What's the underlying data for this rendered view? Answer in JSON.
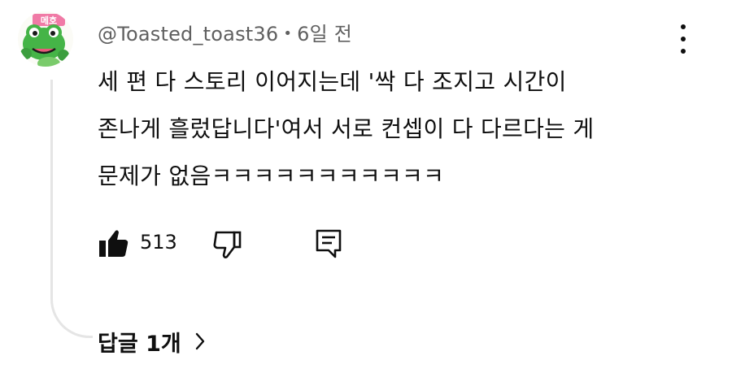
{
  "comment": {
    "author": "@Toasted_toast36",
    "separator": "•",
    "timestamp": "6일 전",
    "text_lines": [
      "세 편 다 스토리 이어지는데 '싹 다 조지고 시간이",
      "존나게 흘렀답니다'여서 서로 컨셉이 다 다르다는 게",
      "문제가 없음ㅋㅋㅋㅋㅋㅋㅋㅋㅋㅋㅋ"
    ],
    "like_count": "513",
    "replies_label": "답글 1개"
  },
  "icons": {
    "avatar": "frog-avatar-icon",
    "like": "thumbs-up-filled-icon",
    "dislike": "thumbs-down-outline-icon",
    "reply": "reply-comment-icon",
    "menu": "more-vertical-icon",
    "expand": "chevron-right-icon"
  },
  "avatar_text": "메호",
  "colors": {
    "text": "#0f0f0f",
    "meta": "#606060",
    "thread_line": "#e5e5e5",
    "avatar_frog": "#45b447"
  }
}
